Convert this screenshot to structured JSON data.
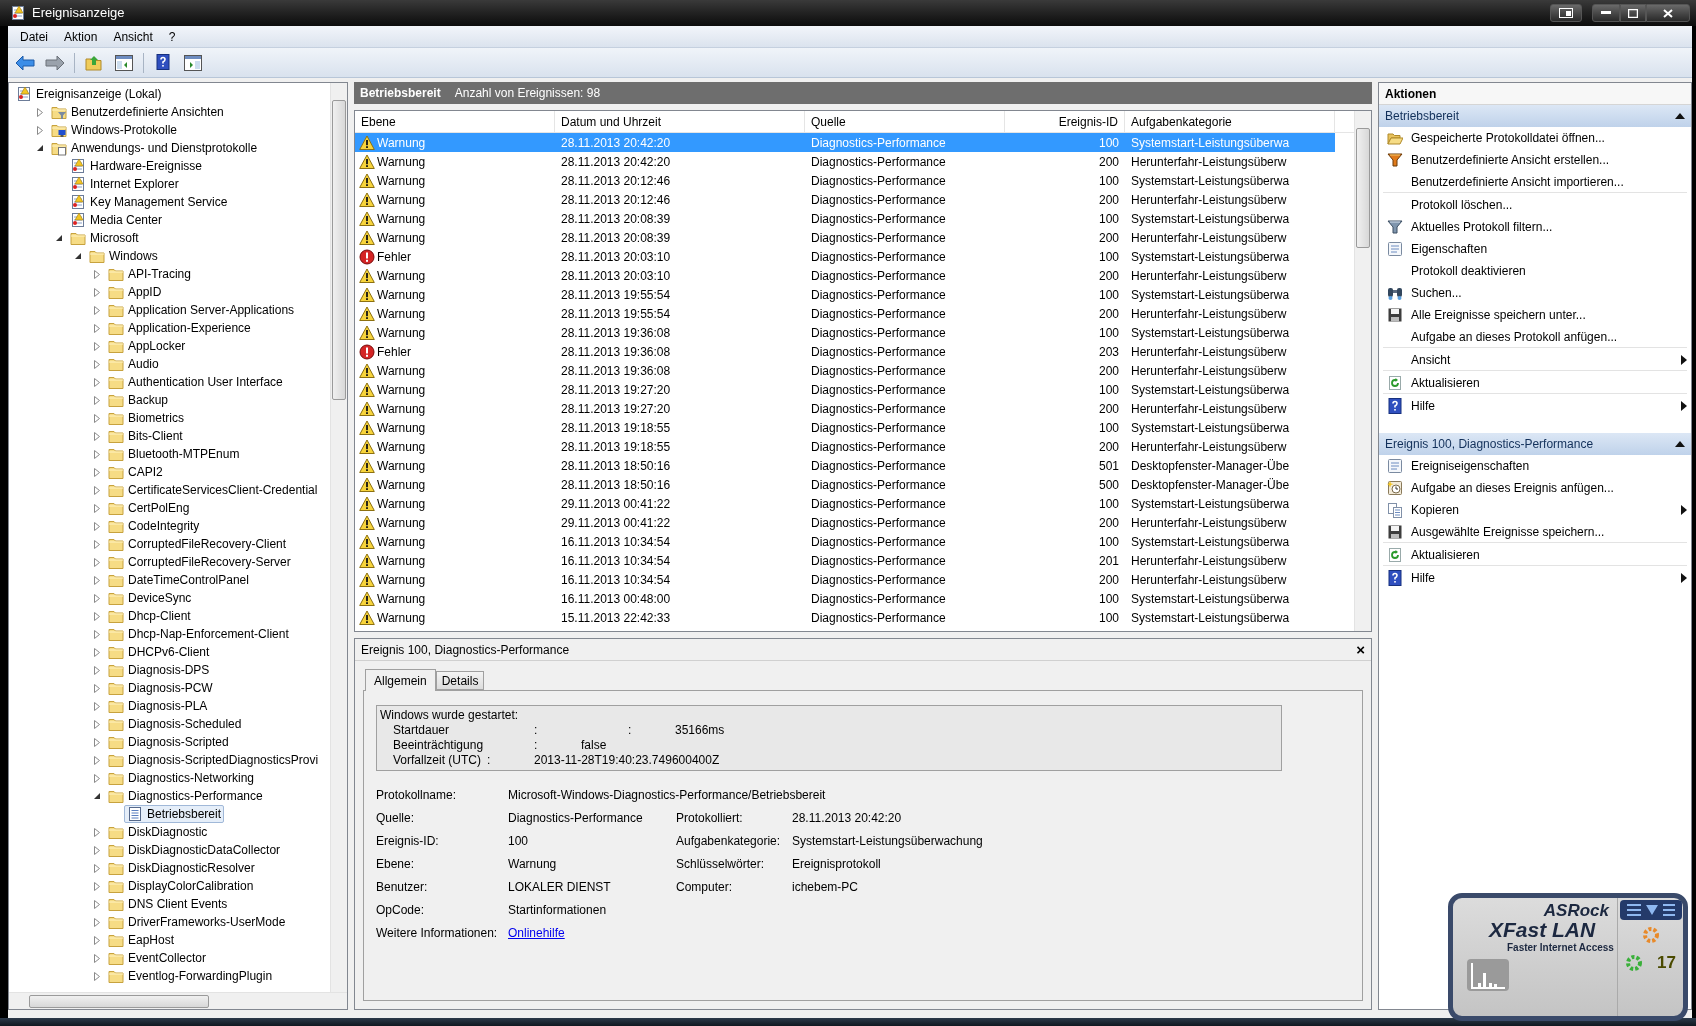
{
  "window": {
    "title": "Ereignisanzeige"
  },
  "menu": [
    "Datei",
    "Aktion",
    "Ansicht",
    "?"
  ],
  "tree": [
    {
      "label": "Ereignisanzeige (Lokal)",
      "kind": "root",
      "selected": false,
      "children": [
        {
          "label": "Benutzerdefinierte Ansichten",
          "kind": "custom-views",
          "expanded": false,
          "selected": false
        },
        {
          "label": "Windows-Protokolle",
          "kind": "windows-logs",
          "expanded": false,
          "selected": false
        },
        {
          "label": "Anwendungs- und Dienstprotokolle",
          "kind": "app-logs",
          "expanded": true,
          "selected": false,
          "children": [
            {
              "label": "Hardware-Ereignisse",
              "kind": "log",
              "selected": false
            },
            {
              "label": "Internet Explorer",
              "kind": "log",
              "selected": false
            },
            {
              "label": "Key Management Service",
              "kind": "log",
              "selected": false
            },
            {
              "label": "Media Center",
              "kind": "log",
              "selected": false
            },
            {
              "label": "Microsoft",
              "kind": "folder",
              "expanded": true,
              "selected": false,
              "children": [
                {
                  "label": "Windows",
                  "kind": "folder",
                  "expanded": true,
                  "selected": false,
                  "children": [
                    {
                      "label": "API-Tracing",
                      "kind": "folder",
                      "expanded": false,
                      "selected": false
                    },
                    {
                      "label": "AppID",
                      "kind": "folder",
                      "expanded": false,
                      "selected": false
                    },
                    {
                      "label": "Application Server-Applications",
                      "kind": "folder",
                      "expanded": false,
                      "selected": false
                    },
                    {
                      "label": "Application-Experience",
                      "kind": "folder",
                      "expanded": false,
                      "selected": false
                    },
                    {
                      "label": "AppLocker",
                      "kind": "folder",
                      "expanded": false,
                      "selected": false
                    },
                    {
                      "label": "Audio",
                      "kind": "folder",
                      "expanded": false,
                      "selected": false
                    },
                    {
                      "label": "Authentication User Interface",
                      "kind": "folder",
                      "expanded": false,
                      "selected": false
                    },
                    {
                      "label": "Backup",
                      "kind": "folder",
                      "expanded": false,
                      "selected": false
                    },
                    {
                      "label": "Biometrics",
                      "kind": "folder",
                      "expanded": false,
                      "selected": false
                    },
                    {
                      "label": "Bits-Client",
                      "kind": "folder",
                      "expanded": false,
                      "selected": false
                    },
                    {
                      "label": "Bluetooth-MTPEnum",
                      "kind": "folder",
                      "expanded": false,
                      "selected": false
                    },
                    {
                      "label": "CAPI2",
                      "kind": "folder",
                      "expanded": false,
                      "selected": false
                    },
                    {
                      "label": "CertificateServicesClient-Credential",
                      "kind": "folder",
                      "expanded": false,
                      "selected": false
                    },
                    {
                      "label": "CertPolEng",
                      "kind": "folder",
                      "expanded": false,
                      "selected": false
                    },
                    {
                      "label": "CodeIntegrity",
                      "kind": "folder",
                      "expanded": false,
                      "selected": false
                    },
                    {
                      "label": "CorruptedFileRecovery-Client",
                      "kind": "folder",
                      "expanded": false,
                      "selected": false
                    },
                    {
                      "label": "CorruptedFileRecovery-Server",
                      "kind": "folder",
                      "expanded": false,
                      "selected": false
                    },
                    {
                      "label": "DateTimeControlPanel",
                      "kind": "folder",
                      "expanded": false,
                      "selected": false
                    },
                    {
                      "label": "DeviceSync",
                      "kind": "folder",
                      "expanded": false,
                      "selected": false
                    },
                    {
                      "label": "Dhcp-Client",
                      "kind": "folder",
                      "expanded": false,
                      "selected": false
                    },
                    {
                      "label": "Dhcp-Nap-Enforcement-Client",
                      "kind": "folder",
                      "expanded": false,
                      "selected": false
                    },
                    {
                      "label": "DHCPv6-Client",
                      "kind": "folder",
                      "expanded": false,
                      "selected": false
                    },
                    {
                      "label": "Diagnosis-DPS",
                      "kind": "folder",
                      "expanded": false,
                      "selected": false
                    },
                    {
                      "label": "Diagnosis-PCW",
                      "kind": "folder",
                      "expanded": false,
                      "selected": false
                    },
                    {
                      "label": "Diagnosis-PLA",
                      "kind": "folder",
                      "expanded": false,
                      "selected": false
                    },
                    {
                      "label": "Diagnosis-Scheduled",
                      "kind": "folder",
                      "expanded": false,
                      "selected": false
                    },
                    {
                      "label": "Diagnosis-Scripted",
                      "kind": "folder",
                      "expanded": false,
                      "selected": false
                    },
                    {
                      "label": "Diagnosis-ScriptedDiagnosticsProvi",
                      "kind": "folder",
                      "expanded": false,
                      "selected": false
                    },
                    {
                      "label": "Diagnostics-Networking",
                      "kind": "folder",
                      "expanded": false,
                      "selected": false
                    },
                    {
                      "label": "Diagnostics-Performance",
                      "kind": "folder",
                      "expanded": true,
                      "selected": false,
                      "children": [
                        {
                          "label": "Betriebsbereit",
                          "kind": "page",
                          "selected": true
                        }
                      ]
                    },
                    {
                      "label": "DiskDiagnostic",
                      "kind": "folder",
                      "expanded": false,
                      "selected": false
                    },
                    {
                      "label": "DiskDiagnosticDataCollector",
                      "kind": "folder",
                      "expanded": false,
                      "selected": false
                    },
                    {
                      "label": "DiskDiagnosticResolver",
                      "kind": "folder",
                      "expanded": false,
                      "selected": false
                    },
                    {
                      "label": "DisplayColorCalibration",
                      "kind": "folder",
                      "expanded": false,
                      "selected": false
                    },
                    {
                      "label": "DNS Client Events",
                      "kind": "folder",
                      "expanded": false,
                      "selected": false
                    },
                    {
                      "label": "DriverFrameworks-UserMode",
                      "kind": "folder",
                      "expanded": false,
                      "selected": false
                    },
                    {
                      "label": "EapHost",
                      "kind": "folder",
                      "expanded": false,
                      "selected": false
                    },
                    {
                      "label": "EventCollector",
                      "kind": "folder",
                      "expanded": false,
                      "selected": false
                    },
                    {
                      "label": "Eventlog-ForwardingPlugin",
                      "kind": "folder",
                      "expanded": false,
                      "selected": false
                    }
                  ]
                }
              ]
            }
          ]
        }
      ]
    }
  ],
  "log_header": {
    "title": "Betriebsbereit",
    "count": "Anzahl von Ereignissen: 98"
  },
  "table": {
    "columns": [
      "Ebene",
      "Datum und Uhrzeit",
      "Quelle",
      "Ereignis-ID",
      "Aufgabenkategorie"
    ],
    "rows": [
      {
        "kind": "warning",
        "level": "Warnung",
        "date": "28.11.2013 20:42:20",
        "source": "Diagnostics-Performance",
        "id": "100",
        "category": "Systemstart-Leistungsüberwa",
        "selected": true
      },
      {
        "kind": "warning",
        "level": "Warnung",
        "date": "28.11.2013 20:42:20",
        "source": "Diagnostics-Performance",
        "id": "200",
        "category": "Herunterfahr-Leistungsüberw",
        "selected": false
      },
      {
        "kind": "warning",
        "level": "Warnung",
        "date": "28.11.2013 20:12:46",
        "source": "Diagnostics-Performance",
        "id": "100",
        "category": "Systemstart-Leistungsüberwa",
        "selected": false
      },
      {
        "kind": "warning",
        "level": "Warnung",
        "date": "28.11.2013 20:12:46",
        "source": "Diagnostics-Performance",
        "id": "200",
        "category": "Herunterfahr-Leistungsüberw",
        "selected": false
      },
      {
        "kind": "warning",
        "level": "Warnung",
        "date": "28.11.2013 20:08:39",
        "source": "Diagnostics-Performance",
        "id": "100",
        "category": "Systemstart-Leistungsüberwa",
        "selected": false
      },
      {
        "kind": "warning",
        "level": "Warnung",
        "date": "28.11.2013 20:08:39",
        "source": "Diagnostics-Performance",
        "id": "200",
        "category": "Herunterfahr-Leistungsüberw",
        "selected": false
      },
      {
        "kind": "error",
        "level": "Fehler",
        "date": "28.11.2013 20:03:10",
        "source": "Diagnostics-Performance",
        "id": "100",
        "category": "Systemstart-Leistungsüberwa",
        "selected": false
      },
      {
        "kind": "warning",
        "level": "Warnung",
        "date": "28.11.2013 20:03:10",
        "source": "Diagnostics-Performance",
        "id": "200",
        "category": "Herunterfahr-Leistungsüberw",
        "selected": false
      },
      {
        "kind": "warning",
        "level": "Warnung",
        "date": "28.11.2013 19:55:54",
        "source": "Diagnostics-Performance",
        "id": "100",
        "category": "Systemstart-Leistungsüberwa",
        "selected": false
      },
      {
        "kind": "warning",
        "level": "Warnung",
        "date": "28.11.2013 19:55:54",
        "source": "Diagnostics-Performance",
        "id": "200",
        "category": "Herunterfahr-Leistungsüberw",
        "selected": false
      },
      {
        "kind": "warning",
        "level": "Warnung",
        "date": "28.11.2013 19:36:08",
        "source": "Diagnostics-Performance",
        "id": "100",
        "category": "Systemstart-Leistungsüberwa",
        "selected": false
      },
      {
        "kind": "error",
        "level": "Fehler",
        "date": "28.11.2013 19:36:08",
        "source": "Diagnostics-Performance",
        "id": "203",
        "category": "Herunterfahr-Leistungsüberw",
        "selected": false
      },
      {
        "kind": "warning",
        "level": "Warnung",
        "date": "28.11.2013 19:36:08",
        "source": "Diagnostics-Performance",
        "id": "200",
        "category": "Herunterfahr-Leistungsüberw",
        "selected": false
      },
      {
        "kind": "warning",
        "level": "Warnung",
        "date": "28.11.2013 19:27:20",
        "source": "Diagnostics-Performance",
        "id": "100",
        "category": "Systemstart-Leistungsüberwa",
        "selected": false
      },
      {
        "kind": "warning",
        "level": "Warnung",
        "date": "28.11.2013 19:27:20",
        "source": "Diagnostics-Performance",
        "id": "200",
        "category": "Herunterfahr-Leistungsüberw",
        "selected": false
      },
      {
        "kind": "warning",
        "level": "Warnung",
        "date": "28.11.2013 19:18:55",
        "source": "Diagnostics-Performance",
        "id": "100",
        "category": "Systemstart-Leistungsüberwa",
        "selected": false
      },
      {
        "kind": "warning",
        "level": "Warnung",
        "date": "28.11.2013 19:18:55",
        "source": "Diagnostics-Performance",
        "id": "200",
        "category": "Herunterfahr-Leistungsüberw",
        "selected": false
      },
      {
        "kind": "warning",
        "level": "Warnung",
        "date": "28.11.2013 18:50:16",
        "source": "Diagnostics-Performance",
        "id": "501",
        "category": "Desktopfenster-Manager-Übe",
        "selected": false
      },
      {
        "kind": "warning",
        "level": "Warnung",
        "date": "28.11.2013 18:50:16",
        "source": "Diagnostics-Performance",
        "id": "500",
        "category": "Desktopfenster-Manager-Übe",
        "selected": false
      },
      {
        "kind": "warning",
        "level": "Warnung",
        "date": "29.11.2013 00:41:22",
        "source": "Diagnostics-Performance",
        "id": "100",
        "category": "Systemstart-Leistungsüberwa",
        "selected": false
      },
      {
        "kind": "warning",
        "level": "Warnung",
        "date": "29.11.2013 00:41:22",
        "source": "Diagnostics-Performance",
        "id": "200",
        "category": "Herunterfahr-Leistungsüberw",
        "selected": false
      },
      {
        "kind": "warning",
        "level": "Warnung",
        "date": "16.11.2013 10:34:54",
        "source": "Diagnostics-Performance",
        "id": "100",
        "category": "Systemstart-Leistungsüberwa",
        "selected": false
      },
      {
        "kind": "warning",
        "level": "Warnung",
        "date": "16.11.2013 10:34:54",
        "source": "Diagnostics-Performance",
        "id": "201",
        "category": "Herunterfahr-Leistungsüberw",
        "selected": false
      },
      {
        "kind": "warning",
        "level": "Warnung",
        "date": "16.11.2013 10:34:54",
        "source": "Diagnostics-Performance",
        "id": "200",
        "category": "Herunterfahr-Leistungsüberw",
        "selected": false
      },
      {
        "kind": "warning",
        "level": "Warnung",
        "date": "16.11.2013 00:48:00",
        "source": "Diagnostics-Performance",
        "id": "100",
        "category": "Systemstart-Leistungsüberwa",
        "selected": false
      },
      {
        "kind": "warning",
        "level": "Warnung",
        "date": "15.11.2013 22:42:33",
        "source": "Diagnostics-Performance",
        "id": "100",
        "category": "Systemstart-Leistungsüberwa",
        "selected": false
      }
    ]
  },
  "detail": {
    "title": "Ereignis 100, Diagnostics-Performance",
    "close": "×",
    "tabs": [
      {
        "label": "Allgemein",
        "selected": true
      },
      {
        "label": "Details",
        "selected": false
      }
    ],
    "message": {
      "heading": "Windows wurde gestartet:",
      "lines": [
        "Startdauer\t\t:\t\t:\t35166ms",
        "Beeinträchtigung\t\t:\tfalse",
        "Vorfallzeit (UTC)\t:\t2013-11-28T19:40:23.749600400Z"
      ]
    },
    "fields": [
      [
        {
          "label": "Protokollname:",
          "value": "Microsoft-Windows-Diagnostics-Performance/Betriebsbereit"
        }
      ],
      [
        {
          "label": "Quelle:",
          "value": "Diagnostics-Performance"
        },
        {
          "label": "Protokolliert:",
          "value": "28.11.2013 20:42:20"
        }
      ],
      [
        {
          "label": "Ereignis-ID:",
          "value": "100"
        },
        {
          "label": "Aufgabenkategorie:",
          "value": "Systemstart-Leistungsüberwachung"
        }
      ],
      [
        {
          "label": "Ebene:",
          "value": "Warnung"
        },
        {
          "label": "Schlüsselwörter:",
          "value": "Ereignisprotokoll"
        }
      ],
      [
        {
          "label": "Benutzer:",
          "value": "LOKALER DIENST"
        },
        {
          "label": "Computer:",
          "value": "ichebem-PC"
        }
      ],
      [
        {
          "label": "OpCode:",
          "value": "Startinformationen"
        }
      ]
    ],
    "more_info": {
      "label": "Weitere Informationen:",
      "link": "Onlinehilfe"
    }
  },
  "actions": {
    "title": "Aktionen",
    "sections": [
      {
        "title": "Betriebsbereit",
        "expanded": true,
        "items": [
          {
            "label": "Gespeicherte Protokolldatei öffnen...",
            "kind": "open-folder",
            "submenu": false,
            "separator_after": false
          },
          {
            "label": "Benutzerdefinierte Ansicht erstellen...",
            "kind": "filter-new",
            "submenu": false,
            "separator_after": false
          },
          {
            "label": "Benutzerdefinierte Ansicht importieren...",
            "kind": "none",
            "submenu": false,
            "separator_after": true
          },
          {
            "label": "Protokoll löschen...",
            "kind": "none",
            "submenu": false,
            "separator_after": false
          },
          {
            "label": "Aktuelles Protokoll filtern...",
            "kind": "filter",
            "submenu": false,
            "separator_after": false
          },
          {
            "label": "Eigenschaften",
            "kind": "properties",
            "submenu": false,
            "separator_after": false
          },
          {
            "label": "Protokoll deaktivieren",
            "kind": "none",
            "submenu": false,
            "separator_after": false
          },
          {
            "label": "Suchen...",
            "kind": "find",
            "submenu": false,
            "separator_after": false
          },
          {
            "label": "Alle Ereignisse speichern unter...",
            "kind": "save",
            "submenu": false,
            "separator_after": false
          },
          {
            "label": "Aufgabe an dieses Protokoll anfügen...",
            "kind": "none",
            "submenu": false,
            "separator_after": true
          },
          {
            "label": "Ansicht",
            "kind": "none",
            "submenu": true,
            "separator_after": true
          },
          {
            "label": "Aktualisieren",
            "kind": "refresh",
            "submenu": false,
            "separator_after": true
          },
          {
            "label": "Hilfe",
            "kind": "help",
            "submenu": true,
            "separator_after": false
          }
        ]
      },
      {
        "title": "Ereignis 100, Diagnostics-Performance",
        "expanded": true,
        "items": [
          {
            "label": "Ereigniseigenschaften",
            "kind": "properties",
            "submenu": false,
            "separator_after": false
          },
          {
            "label": "Aufgabe an dieses Ereignis anfügen...",
            "kind": "task",
            "submenu": false,
            "separator_after": false
          },
          {
            "label": "Kopieren",
            "kind": "copy",
            "submenu": true,
            "separator_after": false
          },
          {
            "label": "Ausgewählte Ereignisse speichern...",
            "kind": "save",
            "submenu": false,
            "separator_after": true
          },
          {
            "label": "Aktualisieren",
            "kind": "refresh",
            "submenu": false,
            "separator_after": true
          },
          {
            "label": "Hilfe",
            "kind": "help",
            "submenu": true,
            "separator_after": false
          }
        ]
      }
    ]
  },
  "widget": {
    "brand": "ASRock",
    "product": "XFast LAN",
    "tagline": "Faster Internet Access",
    "count": "17"
  }
}
